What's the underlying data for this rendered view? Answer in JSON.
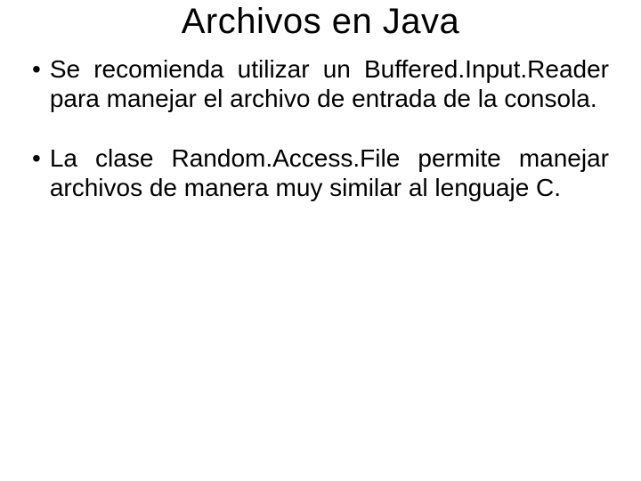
{
  "slide": {
    "title": "Archivos en Java",
    "bullets": [
      {
        "marker": "•",
        "text": "Se recomienda utilizar un Buffered.Input.Reader para manejar el archivo de entrada de la consola."
      },
      {
        "marker": "•",
        "text": "La clase Random.Access.File permite manejar archivos de manera muy similar al lenguaje C."
      }
    ]
  }
}
